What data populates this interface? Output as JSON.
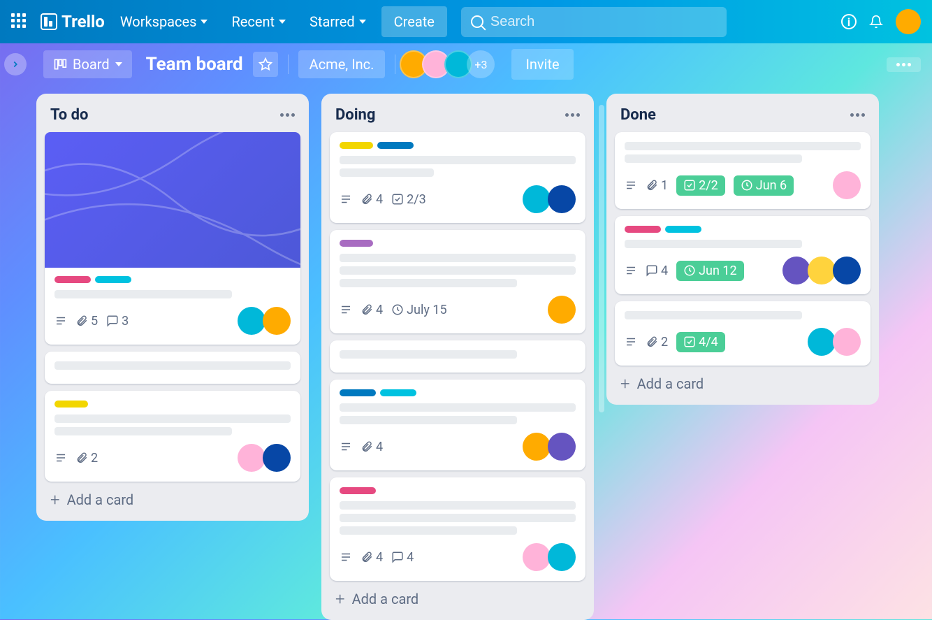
{
  "nav": {
    "brand": "Trello",
    "workspaces": "Workspaces",
    "recent": "Recent",
    "starred": "Starred",
    "create": "Create",
    "search_placeholder": "Search"
  },
  "boardbar": {
    "view_label": "Board",
    "title": "Team board",
    "workspace": "Acme, Inc.",
    "more_members": "+3",
    "invite": "Invite"
  },
  "lists": [
    {
      "title": "To do",
      "add_label": "Add a card",
      "cards": [
        {
          "has_cover": true,
          "labels": [
            "pink",
            "cyan"
          ],
          "placeholders": [
            "w2"
          ],
          "badges": {
            "desc": true,
            "attach": "5",
            "comment": "3"
          },
          "members": [
            "teal",
            "orange"
          ]
        },
        {
          "labels": [],
          "placeholders": [
            "w3"
          ],
          "badges": {},
          "members": []
        },
        {
          "labels": [
            "yellow"
          ],
          "placeholders": [
            "w3",
            "w2"
          ],
          "badges": {
            "desc": true,
            "attach": "2"
          },
          "members": [
            "pink",
            "blue"
          ]
        }
      ]
    },
    {
      "title": "Doing",
      "add_label": "Add a card",
      "cards": [
        {
          "labels": [
            "yellow",
            "blue"
          ],
          "placeholders": [
            "w3",
            "w1"
          ],
          "badges": {
            "desc": true,
            "check": "2/3",
            "attach": "4"
          },
          "members": [
            "teal",
            "blue"
          ]
        },
        {
          "labels": [
            "purple"
          ],
          "placeholders": [
            "w3",
            "w3",
            "w2"
          ],
          "badges": {
            "desc": true,
            "attach": "4",
            "due": "July 15"
          },
          "members": [
            "orange"
          ]
        },
        {
          "labels": [],
          "placeholders": [
            "w2"
          ],
          "badges": {},
          "members": []
        },
        {
          "labels": [
            "blue",
            "cyan"
          ],
          "placeholders": [
            "w3",
            "w2"
          ],
          "badges": {
            "desc": true,
            "attach": "4"
          },
          "members": [
            "orange",
            "purple"
          ]
        },
        {
          "labels": [
            "pink"
          ],
          "placeholders": [
            "w3",
            "w3",
            "w2"
          ],
          "badges": {
            "desc": true,
            "attach": "4",
            "comment": "4"
          },
          "members": [
            "pink",
            "teal"
          ]
        }
      ]
    },
    {
      "title": "Done",
      "add_label": "Add a card",
      "cards": [
        {
          "labels": [],
          "placeholders": [
            "w3",
            "w2"
          ],
          "badges": {
            "desc": true,
            "attach": "1",
            "check_pill": "2/2",
            "due_pill": "Jun 6"
          },
          "members": [
            "pink"
          ]
        },
        {
          "labels": [
            "pink",
            "cyan"
          ],
          "placeholders": [
            "w2"
          ],
          "badges": {
            "desc": true,
            "comment": "4",
            "due_pill": "Jun 12"
          },
          "members": [
            "purple",
            "yellow",
            "blue"
          ]
        },
        {
          "labels": [],
          "placeholders": [
            "w2"
          ],
          "badges": {
            "desc": true,
            "attach": "2",
            "check_pill": "4/4"
          },
          "members": [
            "teal",
            "pink"
          ]
        }
      ]
    }
  ]
}
